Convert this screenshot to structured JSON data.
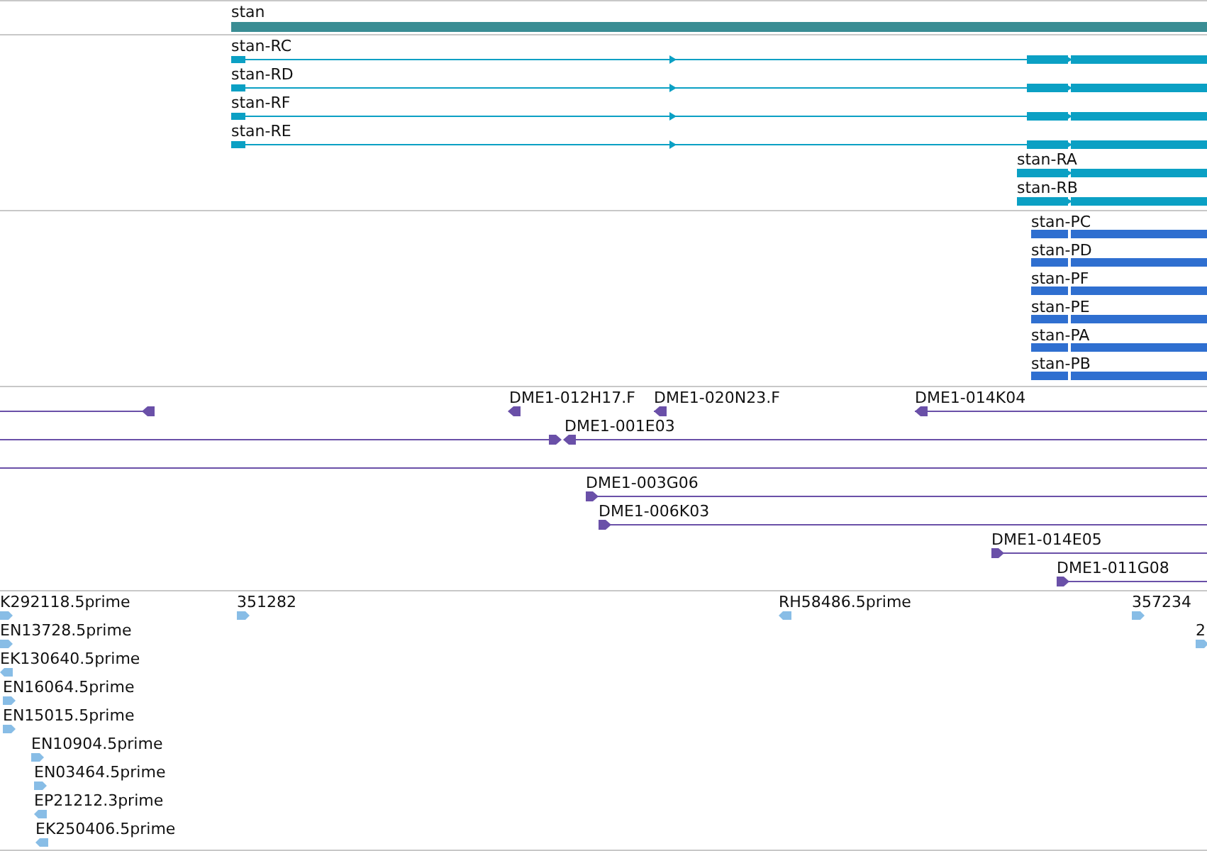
{
  "tracks": [
    {
      "kind": "gene",
      "features": [
        {
          "label": "stan"
        }
      ]
    },
    {
      "kind": "transcript",
      "features": [
        {
          "label": "stan-RC",
          "reverse": false
        },
        {
          "label": "stan-RD",
          "reverse": false
        },
        {
          "label": "stan-RF",
          "reverse": false
        },
        {
          "label": "stan-RE",
          "reverse": false
        },
        {
          "label": "stan-RA",
          "reverse": false
        },
        {
          "label": "stan-RB",
          "reverse": false
        }
      ]
    },
    {
      "kind": "protein",
      "features": [
        {
          "label": "stan-PC"
        },
        {
          "label": "stan-PD"
        },
        {
          "label": "stan-PF"
        },
        {
          "label": "stan-PE"
        },
        {
          "label": "stan-PA"
        },
        {
          "label": "stan-PB"
        }
      ]
    },
    {
      "kind": "clone",
      "features": [
        {
          "arrow": true,
          "reverse": true
        },
        {
          "label": "DME1-012H17.F",
          "arrow": true,
          "reverse": true
        },
        {
          "label": "DME1-020N23.F",
          "arrow": true,
          "reverse": true
        },
        {
          "label": "DME1-014K04",
          "arrow": true,
          "reverse": true
        },
        {
          "arrow": true,
          "reverse": false
        },
        {
          "label": "DME1-001E03",
          "arrow": true,
          "reverse": true
        },
        {
          "arrow": false
        },
        {
          "label": "DME1-003G06",
          "arrow": true,
          "reverse": false
        },
        {
          "label": "DME1-006K03",
          "arrow": true,
          "reverse": false
        },
        {
          "label": "DME1-014E05",
          "arrow": true,
          "reverse": false
        },
        {
          "label": "DME1-011G08",
          "arrow": true,
          "reverse": false
        }
      ]
    },
    {
      "kind": "est",
      "features": [
        {
          "label": "K292118.5prime",
          "reverse": false
        },
        {
          "label": "EN13728.5prime",
          "reverse": false
        },
        {
          "label": "EK130640.5prime",
          "reverse": true
        },
        {
          "label": "EN16064.5prime",
          "reverse": false
        },
        {
          "label": "EN15015.5prime",
          "reverse": false
        },
        {
          "label": "EN10904.5prime",
          "reverse": false
        },
        {
          "label": "EN03464.5prime",
          "reverse": false
        },
        {
          "label": "EP21212.3prime",
          "reverse": true
        },
        {
          "label": "EK250406.5prime",
          "reverse": true
        },
        {
          "label": "351282",
          "reverse": false
        },
        {
          "label": "RH58486.5prime",
          "reverse": true
        },
        {
          "label": "357234",
          "reverse": false
        },
        {
          "label": "2",
          "reverse": false
        }
      ]
    }
  ]
}
